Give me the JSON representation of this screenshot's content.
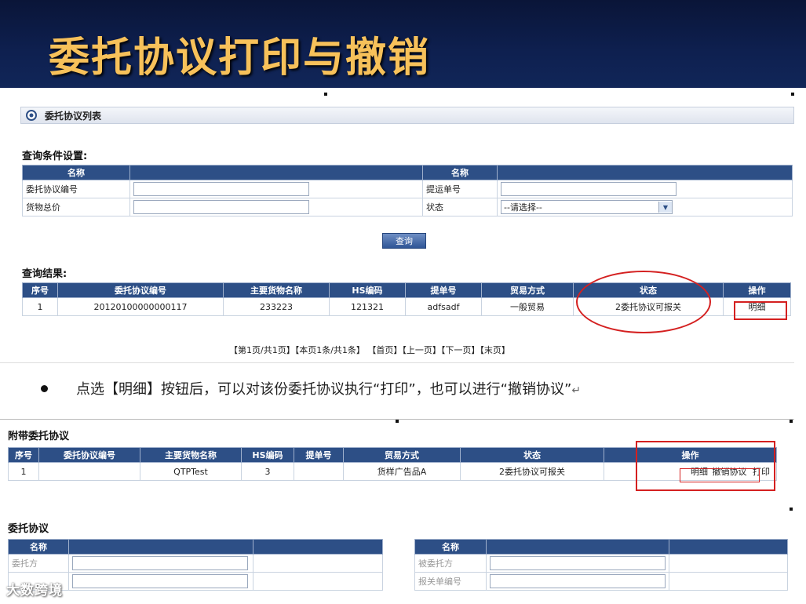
{
  "slide": {
    "title": "委托协议打印与撤销"
  },
  "list_panel": {
    "title": "委托协议列表",
    "query_label": "查询条件设置:",
    "query_headers": [
      "名称",
      "名称"
    ],
    "fields": {
      "agreement_no": "委托协议编号",
      "bill_no": "提运单号",
      "total_price": "货物总价",
      "status": "状态",
      "status_value": "--请选择--"
    },
    "query_button": "查询",
    "results_label": "查询结果:",
    "columns": [
      "序号",
      "委托协议编号",
      "主要货物名称",
      "HS编码",
      "提单号",
      "贸易方式",
      "状态",
      "操作"
    ],
    "row": [
      "1",
      "20120100000000117",
      "233223",
      "121321",
      "adfsadf",
      "一般贸易",
      "2委托协议可报关"
    ],
    "row_action": "明细",
    "pager": "【第1页/共1页】【本页1条/共1条】 【首页】【上一页】【下一页】【末页】"
  },
  "instruction": {
    "text": "点选【明细】按钮后，可以对该份委托协议执行“打印”，也可以进行“撤销协议”",
    "mark": "↵"
  },
  "attached": {
    "title": "附带委托协议",
    "columns": [
      "序号",
      "委托协议编号",
      "主要货物名称",
      "HS编码",
      "提单号",
      "贸易方式",
      "状态",
      "操作"
    ],
    "row": [
      "1",
      "",
      "QTPTest",
      "3",
      "",
      "货样广告品A",
      "2委托协议可报关"
    ],
    "actions": {
      "detail": "明细",
      "revoke": "撤销协议",
      "print": "打印"
    }
  },
  "agreement": {
    "title": "委托协议",
    "header": "名称",
    "left_label": "委托方",
    "right_labels": [
      "被委托方",
      "报关单编号"
    ]
  },
  "watermark": "大数跨境"
}
